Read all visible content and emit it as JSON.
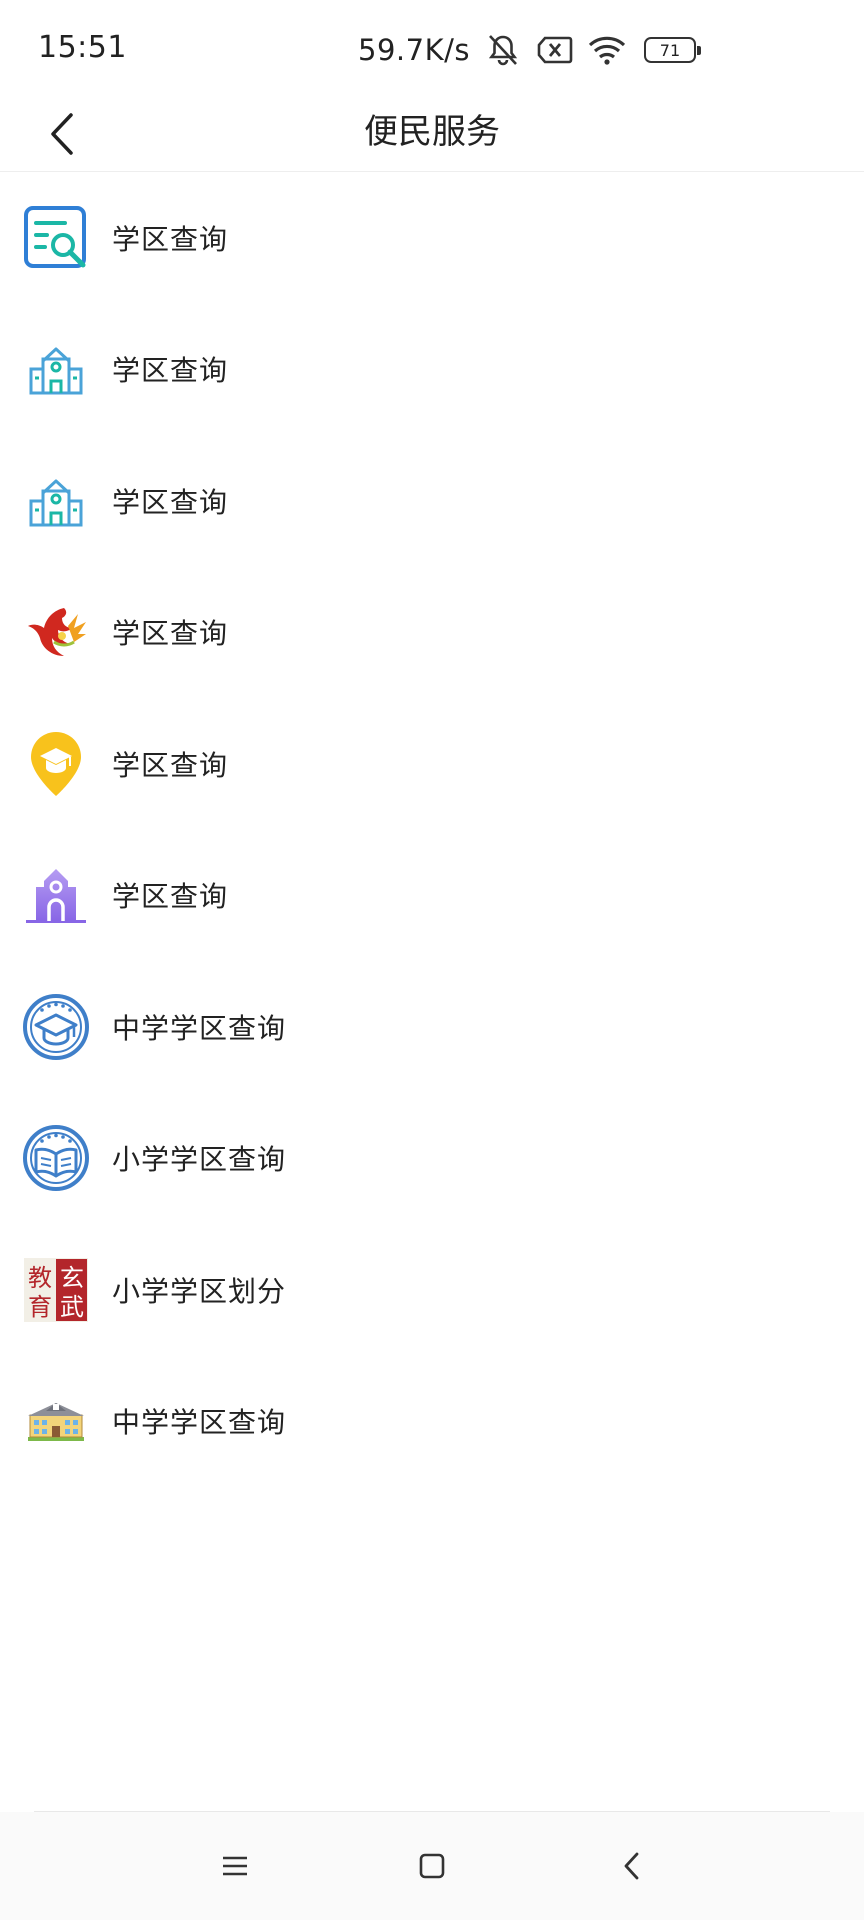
{
  "status_bar": {
    "time": "15:51",
    "net_speed": "59.7K/s",
    "battery_level": "71",
    "icons": [
      "mute-bell-icon",
      "sim-x-icon",
      "wifi-icon",
      "battery-icon"
    ]
  },
  "header": {
    "title": "便民服务",
    "back_icon": "back-chevron-icon"
  },
  "services": [
    {
      "label": "学区查询",
      "icon": "document-search-icon"
    },
    {
      "label": "学区查询",
      "icon": "school-building-outline-icon"
    },
    {
      "label": "学区查询",
      "icon": "school-building-outline-icon"
    },
    {
      "label": "学区查询",
      "icon": "red-bird-logo-icon"
    },
    {
      "label": "学区查询",
      "icon": "yellow-pin-graduation-cap-icon"
    },
    {
      "label": "学区查询",
      "icon": "purple-school-icon"
    },
    {
      "label": "中学学区查询",
      "icon": "blue-circle-graduation-cap-icon"
    },
    {
      "label": "小学学区查询",
      "icon": "blue-circle-book-icon"
    },
    {
      "label": "小学学区划分",
      "icon": "education-xuanwu-logo-icon"
    },
    {
      "label": "中学学区查询",
      "icon": "school-building-color-icon"
    }
  ],
  "logo_text": {
    "tl": "教",
    "tr": "玄",
    "bl": "育",
    "br": "武"
  },
  "nav_bar": {
    "icons": [
      "menu-icon",
      "home-square-icon",
      "back-icon"
    ]
  },
  "colors": {
    "blue": "#2f7fd6",
    "teal": "#1bb7a6",
    "light_blue": "#4aa3d8",
    "red": "#d0281f",
    "yellow": "#f8c21c",
    "purple": "#9a7be8",
    "circle_blue": "#3f7fc9"
  }
}
